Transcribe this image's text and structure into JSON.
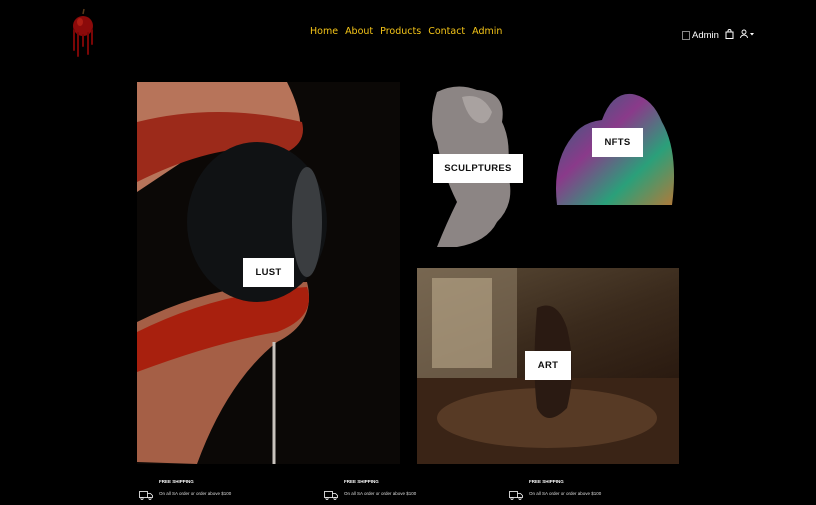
{
  "nav": {
    "items": [
      {
        "label": "Home"
      },
      {
        "label": "About"
      },
      {
        "label": "Products"
      },
      {
        "label": "Contact"
      },
      {
        "label": "Admin"
      }
    ]
  },
  "header_right": {
    "admin_alt": "Admin",
    "icons": [
      "shopping-bag-icon",
      "user-dropdown-icon"
    ]
  },
  "tiles": {
    "lust": "LUST",
    "sculptures": "SCULPTURES",
    "nfts": "NFTS",
    "art": "ART"
  },
  "features": [
    {
      "title": "FREE SHIPPING",
      "subtitle": "On all SA order or order above $100"
    },
    {
      "title": "FREE SHIPPING",
      "subtitle": "On all SA order or order above $100"
    },
    {
      "title": "FREE SHIPPING",
      "subtitle": "On all SA order or order above $100"
    }
  ],
  "colors": {
    "background": "#000000",
    "nav_link": "#f5c518",
    "label_bg": "#ffffff"
  }
}
